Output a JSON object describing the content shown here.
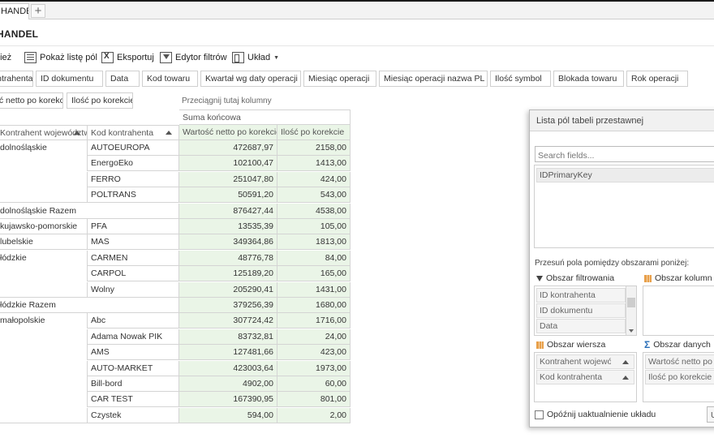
{
  "tabs": [
    {
      "label": "HANDEL"
    }
  ],
  "page_title": "HANDEL",
  "toolbar": {
    "refresh_label": "Odśwież",
    "show_field_list_label": "Pokaż listę pól",
    "export_label": "Eksportuj",
    "filter_editor_label": "Edytor filtrów",
    "layout_label": "Układ"
  },
  "filter_fields": [
    "Nazwa kontrahenta",
    "ID dokumentu",
    "Data",
    "Kod towaru",
    "Kwartał wg daty operacji",
    "Miesiąc operacji",
    "Miesiąc operacji nazwa PL",
    "Ilość symbol",
    "Blokada towaru",
    "Rok operacji"
  ],
  "data_fields": [
    "Wartość netto po korekcie",
    "Ilość po korekcie"
  ],
  "column_drop_hint": "Przeciągnij tutaj kolumny",
  "pivot": {
    "grand_total_label": "Suma końcowa",
    "row_headers": [
      "Kontrahent województwo",
      "Kod kontrahenta"
    ],
    "value_headers": [
      "Wartość netto po korekcie",
      "Ilość po korekcie"
    ],
    "rows": [
      {
        "region": "dolnośląskie",
        "code": "AUTOEUROPA",
        "value": "472687,97",
        "qty": "2158,00"
      },
      {
        "region": "",
        "code": "EnergoEko",
        "value": "102100,47",
        "qty": "1413,00"
      },
      {
        "region": "",
        "code": "FERRO",
        "value": "251047,80",
        "qty": "424,00"
      },
      {
        "region": "",
        "code": "POLTRANS",
        "value": "50591,20",
        "qty": "543,00"
      },
      {
        "region": "dolnośląskie Razem",
        "code": "",
        "value": "876427,44",
        "qty": "4538,00",
        "subtotal": true
      },
      {
        "region": "kujawsko-pomorskie",
        "code": "PFA",
        "value": "13535,39",
        "qty": "105,00"
      },
      {
        "region": "lubelskie",
        "code": "MAS",
        "value": "349364,86",
        "qty": "1813,00"
      },
      {
        "region": "łódzkie",
        "code": "CARMEN",
        "value": "48776,78",
        "qty": "84,00"
      },
      {
        "region": "",
        "code": "CARPOL",
        "value": "125189,20",
        "qty": "165,00"
      },
      {
        "region": "",
        "code": "Wolny",
        "value": "205290,41",
        "qty": "1431,00"
      },
      {
        "region": "łódzkie Razem",
        "code": "",
        "value": "379256,39",
        "qty": "1680,00",
        "subtotal": true
      },
      {
        "region": "małopolskie",
        "code": "Abc",
        "value": "307724,42",
        "qty": "1716,00"
      },
      {
        "region": "",
        "code": "Adama Nowak PIK",
        "value": "83732,81",
        "qty": "24,00"
      },
      {
        "region": "",
        "code": "AMS",
        "value": "127481,66",
        "qty": "423,00"
      },
      {
        "region": "",
        "code": "AUTO-MARKET",
        "value": "423003,64",
        "qty": "1973,00"
      },
      {
        "region": "",
        "code": "Bill-bord",
        "value": "4902,00",
        "qty": "60,00"
      },
      {
        "region": "",
        "code": "CAR TEST",
        "value": "167390,95",
        "qty": "801,00"
      },
      {
        "region": "",
        "code": "Czystek",
        "value": "594,00",
        "qty": "2,00"
      }
    ]
  },
  "field_list": {
    "title": "Lista pól tabeli przestawnej",
    "search_placeholder": "Search fields...",
    "available_fields": [
      "IDPrimaryKey"
    ],
    "move_hint": "Przesuń pola pomiędzy obszarami poniżej:",
    "filter_area_label": "Obszar filtrowania",
    "column_area_label": "Obszar kolumn",
    "row_area_label": "Obszar wiersza",
    "data_area_label": "Obszar danych",
    "filter_area_items": [
      "ID kontrahenta",
      "ID dokumentu",
      "Data"
    ],
    "row_area_items": [
      "Kontrahent województwo",
      "Kod kontrahenta"
    ],
    "data_area_items": [
      "Wartość netto po korekcie",
      "Ilość po korekcie"
    ],
    "defer_update_label": "Opóźnij uaktualnienie układu",
    "update_button_label": "Uaktualnij"
  }
}
